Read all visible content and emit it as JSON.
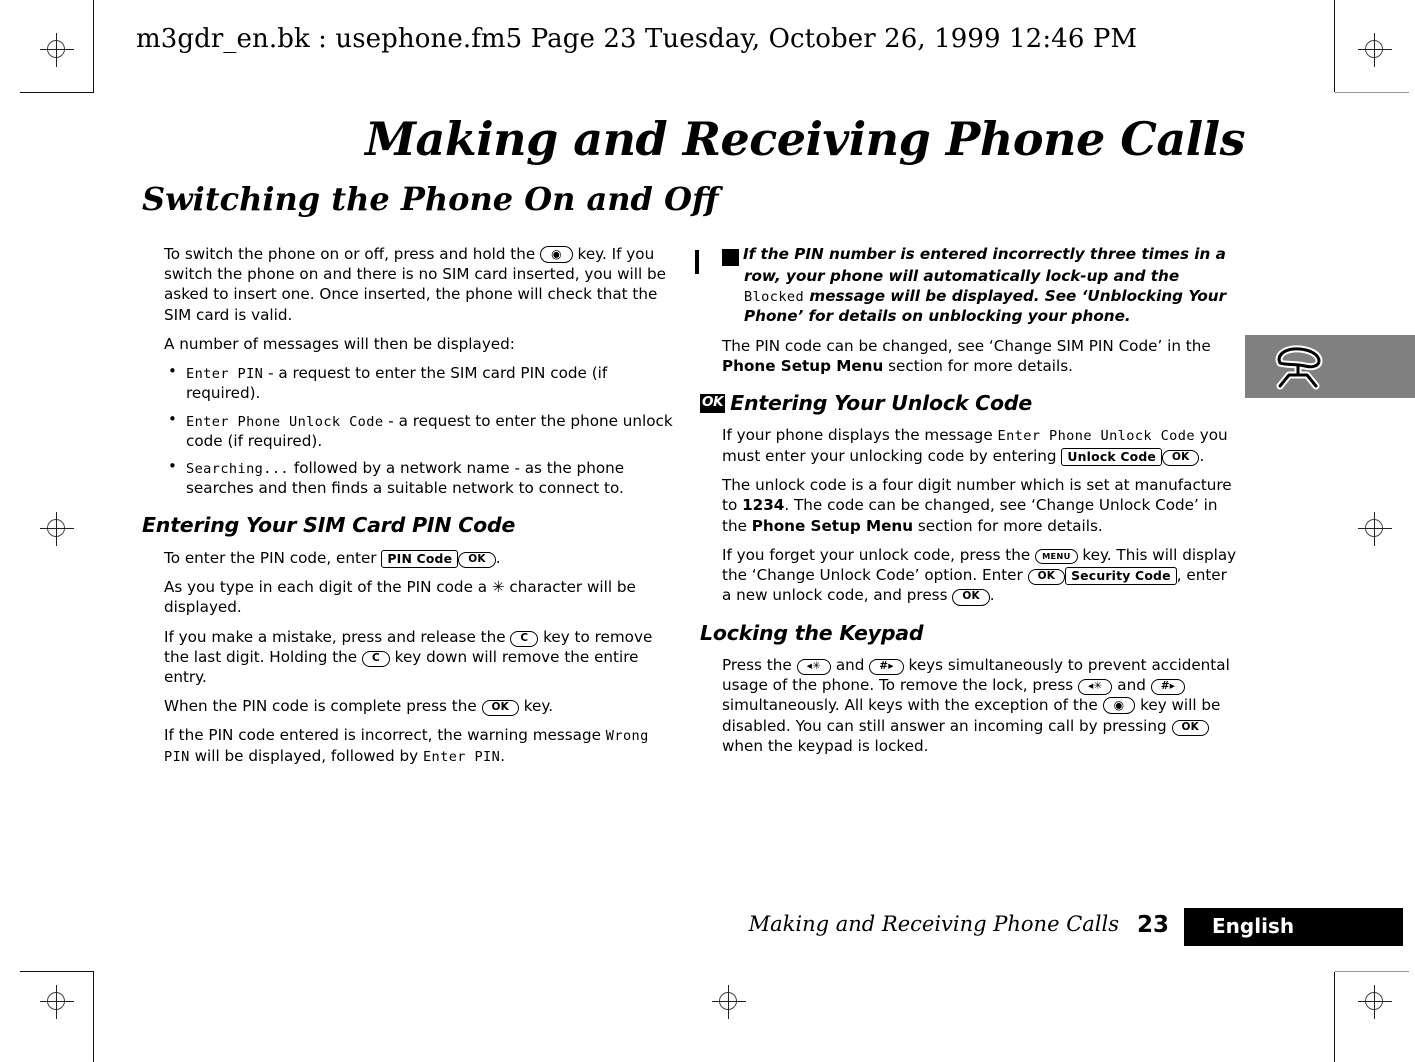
{
  "running_head": "m3gdr_en.bk : usephone.fm5  Page 23  Tuesday, October 26, 1999  12:46 PM",
  "chapter_title": "Making and Receiving Phone Calls",
  "section_title": "Switching the Phone On and Off",
  "left_column": {
    "p1_a": "To switch the phone on or off, press and hold the ",
    "key_power": "◉",
    "p1_b": " key. If you switch the phone on and there is no SIM card inserted, you will be asked to insert one. Once inserted, the phone will check that the SIM card is valid.",
    "p2": "A number of messages will then be displayed:",
    "bullets": [
      {
        "lcd": "Enter PIN",
        "text": " - a request to enter the SIM card PIN code (if required)."
      },
      {
        "lcd": "Enter Phone Unlock Code",
        "text": " - a request to enter the phone unlock code (if required)."
      },
      {
        "lcd": "Searching...",
        "text": " followed by a network name - as the phone searches and then finds a suitable network to connect to."
      }
    ],
    "subheading": "Entering Your SIM Card PIN Code",
    "p3_a": "To enter the PIN code, enter ",
    "key_pin_code": "PIN Code",
    "key_ok": "OK",
    "p3_b": ".",
    "p4": "As you type in each digit of the PIN code a ✳ character will be displayed.",
    "p5_a": "If you make a mistake, press and release the ",
    "key_c": "C",
    "p5_b": " key to remove the last digit. Holding the ",
    "p5_c": " key down will remove the entire entry.",
    "p6_a": "When the PIN code is complete press the ",
    "p6_b": " key.",
    "p7_a": "If the PIN code entered is incorrect, the warning message ",
    "p7_lcd1": "Wrong PIN",
    "p7_b": " will be displayed, followed by ",
    "p7_lcd2": "Enter PIN",
    "p7_c": "."
  },
  "right_column": {
    "warning_icon": "!",
    "warning_a": "If the PIN number is entered incorrectly three times in a row, your phone will automatically lock-up and the ",
    "warning_lcd": "Blocked",
    "warning_b": " message will be displayed. See ‘Unblocking Your Phone’ for details on unblocking your phone.",
    "p1_a": "The PIN code can be changed, see ‘Change SIM PIN Code’ in the ",
    "p1_bold": "Phone Setup Menu",
    "p1_b": " section for more details.",
    "heading_icon": "OK",
    "heading": "Entering Your Unlock Code",
    "p2_a": "If your phone displays the message ",
    "p2_lcd": "Enter Phone Unlock Code",
    "p2_b": " you must enter your unlocking code by entering ",
    "key_unlock_code": "Unlock Code",
    "key_ok": "OK",
    "p2_c": ".",
    "p3_a": "The unlock code is a four digit number which is set at manufacture to ",
    "p3_bold": "1234",
    "p3_b": ". The code can be changed, see ‘Change Unlock Code’ in the ",
    "p3_bold2": "Phone Setup Menu",
    "p3_c": " section for more details.",
    "p4_a": "If you forget your unlock code, press the ",
    "key_menu": "MENU",
    "p4_b": " key. This will display the ‘Change Unlock Code’ option. Enter ",
    "key_security_code": "Security Code",
    "p4_c": ", enter a new unlock code, and press ",
    "p4_d": ".",
    "subheading2": "Locking the Keypad",
    "p5_a": "Press the ",
    "key_star": "◂✳",
    "p5_b": " and ",
    "key_hash": "#▸",
    "p5_c": " keys simultaneously to prevent accidental usage of the phone. To remove the lock, press ",
    "p5_d": " and ",
    "p5_e": " simultaneously. All keys with the exception of the ",
    "key_power": "◉",
    "p5_f": " key will be disabled. You can still answer an incoming call by pressing ",
    "p5_g": " when the keypad is locked."
  },
  "tab_marker": {
    "icon": "phone-handset-icon",
    "background_color": "#808080"
  },
  "footer": {
    "title": "Making and Receiving Phone Calls",
    "page_number": "23",
    "language": "English",
    "language_box_color": "#000000"
  }
}
